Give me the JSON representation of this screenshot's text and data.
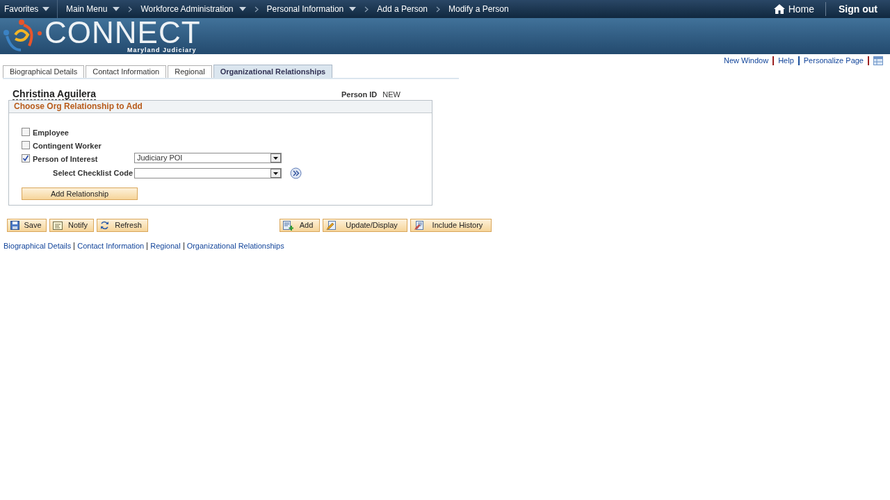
{
  "nav": {
    "favorites": "Favorites",
    "items": [
      {
        "label": "Main Menu",
        "dropdown": true
      },
      {
        "label": "Workforce Administration",
        "dropdown": true
      },
      {
        "label": "Personal Information",
        "dropdown": true
      },
      {
        "label": "Add a Person",
        "dropdown": false
      },
      {
        "label": "Modify a Person",
        "dropdown": false
      }
    ],
    "home": "Home",
    "sign_out": "Sign out"
  },
  "logo": {
    "name": "CONNECT",
    "subtitle": "Maryland Judiciary"
  },
  "page_links": [
    "New Window",
    "Help",
    "Personalize Page"
  ],
  "tabs": [
    {
      "label": "Biographical Details",
      "selected": false
    },
    {
      "label": "Contact Information",
      "selected": false
    },
    {
      "label": "Regional",
      "selected": false
    },
    {
      "label": "Organizational Relationships",
      "selected": true
    }
  ],
  "person": {
    "name": "Christina Aguilera",
    "id_label": "Person ID",
    "id_value": "NEW"
  },
  "section": {
    "title": "Choose Org Relationship to Add",
    "options": [
      {
        "label": "Employee",
        "checked": false
      },
      {
        "label": "Contingent Worker",
        "checked": false
      },
      {
        "label": "Person of Interest",
        "checked": true,
        "select_value": "Judiciary POI"
      }
    ],
    "checklist_label": "Select Checklist Code",
    "add_button": "Add Relationship"
  },
  "toolbar_left": [
    "Save",
    "Notify",
    "Refresh"
  ],
  "toolbar_right": [
    "Add",
    "Update/Display",
    "Include History"
  ],
  "bottom_links": [
    "Biographical Details",
    "Contact Information",
    "Regional",
    "Organizational Relationships"
  ]
}
